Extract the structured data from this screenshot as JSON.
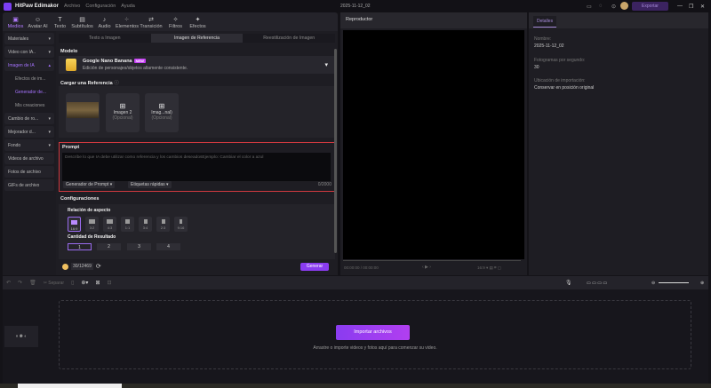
{
  "app": {
    "title": "HitPaw Edimakor",
    "menus": [
      "Archivo",
      "Configuración",
      "Ayuda"
    ],
    "project": "2025-11-12_02",
    "export": "Exportar"
  },
  "tools": [
    "Medios",
    "Avatar AI",
    "Texto",
    "Subtítulos",
    "Audio",
    "Elementos",
    "Transición",
    "Filtros",
    "Efectos"
  ],
  "sidebar": {
    "materiales": "Materiales",
    "video_ia": "Video con IA..",
    "imagen_ia": "Imagen de IA",
    "sub": [
      "Efectos de im...",
      "Generador de...",
      "Mis creaciones"
    ],
    "cambio": "Cambio de ro...",
    "mejorador": "Mejorador d...",
    "fondo": "Fondo",
    "videos": "Videos de archivo",
    "fotos": "Fotos de archivo",
    "gifs": "GIFs de archivo"
  },
  "main": {
    "tabs": [
      "Texto a Imagen",
      "Imagen de Referencia",
      "Reestilización de Imagen"
    ],
    "modelo_label": "Modelo",
    "model_name": "Google Nano Banana",
    "model_badge": "NEW",
    "model_desc": "Edición de personajes/objetos altamente consistente.",
    "ref_label": "Cargar una Referencia",
    "slots": [
      {
        "name": "Imagen 2",
        "opt": "(Opcional)"
      },
      {
        "name": "Imag...nal)",
        "opt": "(Opcional)"
      }
    ],
    "prompt_label": "Prompt",
    "prompt_placeholder": "Describe lo que IA debe utilizar como referencia y los cambios deseadosEjemplo: Cambiar el color a azul",
    "prompt_gen": "Generador de Prompt",
    "quick_tags": "Etiquetas rápidas",
    "char_count": "0/2000",
    "config_label": "Configuraciones",
    "aspect_label": "Relación de aspecto",
    "aspects": [
      "16:9",
      "3:2",
      "4:3",
      "1:1",
      "3:4",
      "2:3",
      "9:16"
    ],
    "count_label": "Cantidad de Resultado",
    "counts": [
      "1",
      "2",
      "3",
      "4"
    ],
    "credits": "30/12469",
    "generate": "Generar"
  },
  "player": {
    "title": "Reproductor",
    "time": "00:00:00 / 00:00:00",
    "ratio": "16:9"
  },
  "details": {
    "tab": "Detalles",
    "name_label": "Nombre:",
    "name": "2025-11-12_02",
    "fps_label": "Fotogramas por segundo:",
    "fps": "30",
    "loc_label": "Ubicación de importación:",
    "loc": "Conservar en posición original"
  },
  "timeline": {
    "split": "Separar",
    "import": "Importar archivos",
    "hint": "Arrastre o importe videos y fotos aquí para comenzar su video."
  }
}
